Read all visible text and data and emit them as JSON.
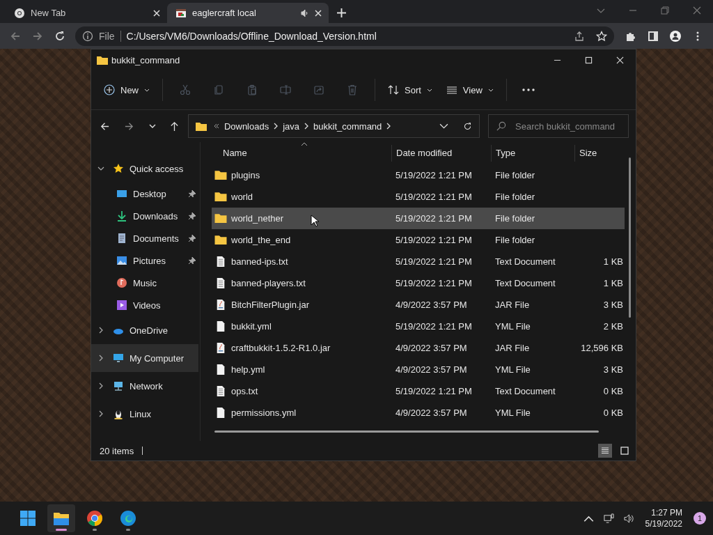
{
  "browser": {
    "tabs": [
      {
        "title": "New Tab",
        "kind": "chrome",
        "selected": false,
        "audio": false
      },
      {
        "title": "eaglercraft local",
        "kind": "page",
        "selected": true,
        "audio": true
      }
    ],
    "address": {
      "scheme": "File",
      "url": "C:/Users/VM6/Downloads/Offline_Download_Version.html"
    }
  },
  "explorer": {
    "title": "bukkit_command",
    "toolbar": {
      "new_label": "New",
      "sort_label": "Sort",
      "view_label": "View",
      "actions": [
        {
          "kind": "cut",
          "disabled": true
        },
        {
          "kind": "copy",
          "disabled": true
        },
        {
          "kind": "paste",
          "disabled": true
        },
        {
          "kind": "rename",
          "disabled": true
        },
        {
          "kind": "share",
          "disabled": true
        },
        {
          "kind": "delete",
          "disabled": true
        }
      ]
    },
    "breadcrumb": [
      "Downloads",
      "java",
      "bukkit_command"
    ],
    "search": {
      "placeholder": "Search bukkit_command"
    },
    "sidebar": [
      {
        "label": "Quick access",
        "kind": "star",
        "expanded": true,
        "selected": false,
        "children": [
          {
            "label": "Desktop",
            "kind": "desktop",
            "pinned": true
          },
          {
            "label": "Downloads",
            "kind": "download",
            "pinned": true
          },
          {
            "label": "Documents",
            "kind": "document",
            "pinned": true
          },
          {
            "label": "Pictures",
            "kind": "pictures",
            "pinned": true
          },
          {
            "label": "Music",
            "kind": "music",
            "pinned": false
          },
          {
            "label": "Videos",
            "kind": "videos",
            "pinned": false
          }
        ]
      },
      {
        "label": "OneDrive",
        "kind": "cloud",
        "expanded": false,
        "selected": false
      },
      {
        "label": "My Computer",
        "kind": "computer",
        "expanded": false,
        "selected": true
      },
      {
        "label": "Network",
        "kind": "network",
        "expanded": false,
        "selected": false
      },
      {
        "label": "Linux",
        "kind": "linux",
        "expanded": false,
        "selected": false
      }
    ],
    "columns": [
      "Name",
      "Date modified",
      "Type",
      "Size"
    ],
    "rows": [
      {
        "name": "plugins",
        "date": "5/19/2022 1:21 PM",
        "type": "File folder",
        "kind": "folder",
        "selected": false
      },
      {
        "name": "world",
        "date": "5/19/2022 1:21 PM",
        "type": "File folder",
        "kind": "folder",
        "selected": false
      },
      {
        "name": "world_nether",
        "date": "5/19/2022 1:21 PM",
        "type": "File folder",
        "kind": "folder",
        "selected": true
      },
      {
        "name": "world_the_end",
        "date": "5/19/2022 1:21 PM",
        "type": "File folder",
        "kind": "folder",
        "selected": false
      },
      {
        "name": "banned-ips.txt",
        "date": "5/19/2022 1:21 PM",
        "type": "Text Document",
        "size": "1 KB",
        "kind": "text",
        "selected": false
      },
      {
        "name": "banned-players.txt",
        "date": "5/19/2022 1:21 PM",
        "type": "Text Document",
        "size": "1 KB",
        "kind": "text",
        "selected": false
      },
      {
        "name": "BitchFilterPlugin.jar",
        "date": "4/9/2022 3:57 PM",
        "type": "JAR File",
        "size": "3 KB",
        "kind": "jar",
        "selected": false
      },
      {
        "name": "bukkit.yml",
        "date": "5/19/2022 1:21 PM",
        "type": "YML File",
        "size": "2 KB",
        "kind": "file",
        "selected": false
      },
      {
        "name": "craftbukkit-1.5.2-R1.0.jar",
        "date": "4/9/2022 3:57 PM",
        "type": "JAR File",
        "size": "12,596 KB",
        "kind": "jar",
        "selected": false
      },
      {
        "name": "help.yml",
        "date": "4/9/2022 3:57 PM",
        "type": "YML File",
        "size": "3 KB",
        "kind": "file",
        "selected": false
      },
      {
        "name": "ops.txt",
        "date": "5/19/2022 1:21 PM",
        "type": "Text Document",
        "size": "0 KB",
        "kind": "text",
        "selected": false
      },
      {
        "name": "permissions.yml",
        "date": "4/9/2022 3:57 PM",
        "type": "YML File",
        "size": "0 KB",
        "kind": "file",
        "selected": false
      }
    ],
    "status": "20 items",
    "views": [
      {
        "kind": "details",
        "selected": true
      },
      {
        "kind": "tiles",
        "selected": false
      }
    ]
  },
  "taskbar": {
    "apps": [
      {
        "kind": "start",
        "active": false,
        "running": false
      },
      {
        "kind": "explorer",
        "active": true,
        "running": true
      },
      {
        "kind": "chrome",
        "active": false,
        "running": true
      },
      {
        "kind": "edge",
        "active": false,
        "running": true
      }
    ],
    "time": "1:27 PM",
    "date": "5/19/2022",
    "notifications": "1"
  }
}
